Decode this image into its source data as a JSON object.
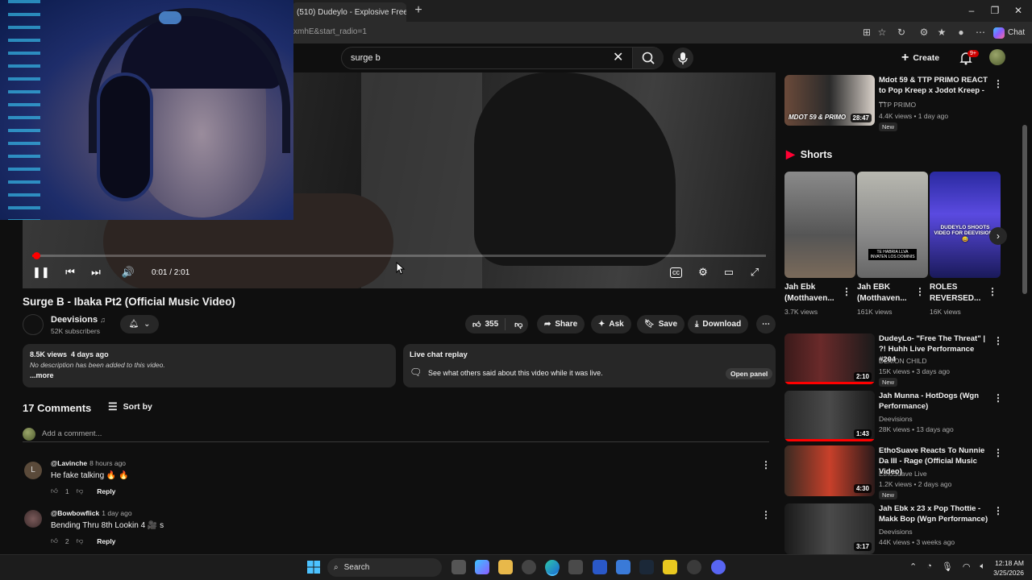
{
  "browser": {
    "tab_title": "(510) Dudeylo - Explosive Freestyle",
    "url_fragment": "xmhE&start_radio=1",
    "copilot_label": "Chat"
  },
  "youtube_header": {
    "search_value": "surge b",
    "create_label": "Create",
    "notification_count": "9+"
  },
  "player": {
    "current_time": "0:01 / 2:01",
    "progress_fraction": 0.008
  },
  "video": {
    "title": "Surge B - Ibaka Pt2 (Official Music Video)",
    "channel_name": "Deevisions",
    "subscribers": "52K subscribers",
    "likes": "355",
    "share_label": "Share",
    "ask_label": "Ask",
    "save_label": "Save",
    "download_label": "Download"
  },
  "description": {
    "views": "8.5K views",
    "age": "4 days ago",
    "text": "No description has been added to this video.",
    "more_label": "...more"
  },
  "live_chat": {
    "heading": "Live chat replay",
    "text": "See what others said about this video while it was live.",
    "button_label": "Open panel"
  },
  "comments": {
    "count_label": "17 Comments",
    "sort_label": "Sort by",
    "add_placeholder": "Add a comment...",
    "items": [
      {
        "initial": "L",
        "handle": "@Lavinche",
        "time": "8 hours ago",
        "text": "He fake talking 🔥 🔥",
        "likes": "1",
        "reply_label": "Reply"
      },
      {
        "initial": "",
        "handle": "@Bowbowflick",
        "time": "1 day ago",
        "text": "Bending Thru 8th Lookin 4 🎥 s",
        "likes": "2",
        "reply_label": "Reply"
      }
    ]
  },
  "sidebar": {
    "top_video": {
      "title": "Mdot 59 & TTP PRIMO REACT to Pop Kreep x Jodot Kreep - ...",
      "channel": "TTP PRIMO",
      "meta": "4.4K views • 1 day ago",
      "badge": "New",
      "duration": "28:47",
      "thumb_text": "MDOT 59 & PRIMO"
    },
    "shorts_heading": "Shorts",
    "shorts": [
      {
        "title": "Jah Ebk (Motthaven...",
        "views": "3.7K views"
      },
      {
        "title": "Jah EBK (Motthaven...",
        "views": "161K views",
        "thumb_text": "TE HABRIA LLVA INVATEN LOS DOMINIS"
      },
      {
        "title": "ROLES REVERSED...",
        "views": "16K views",
        "thumb_text": "DUDEYLO SHOOTS VIDEO FOR DEEVISIONS 😅"
      }
    ],
    "videos": [
      {
        "title": "DudeyLo- \"Free The Threat\" | ?! Huhh Live Performance #204",
        "channel": "DEMON CHILD",
        "meta": "15K views • 3 days ago",
        "badge": "New",
        "duration": "2:10"
      },
      {
        "title": "Jah Munna - HotDogs (Wgn Performance)",
        "channel": "Deevisions",
        "meta": "28K views • 13 days ago",
        "badge": "",
        "duration": "1:43"
      },
      {
        "title": "EthoSuave Reacts To Nunnie Da III - Rage (Official Music Video)",
        "channel": "EthoSuave Live",
        "meta": "1.2K views • 2 days ago",
        "badge": "New",
        "duration": "4:30"
      },
      {
        "title": "Jah Ebk x 23 x Pop Thottie - Makk Bop (Wgn Performance)",
        "channel": "Deevisions",
        "meta": "44K views • 3 weeks ago",
        "badge": "",
        "duration": "3:17"
      }
    ]
  },
  "taskbar": {
    "search_label": "Search",
    "time": "12:18 AM",
    "date": "3/25/2026"
  }
}
